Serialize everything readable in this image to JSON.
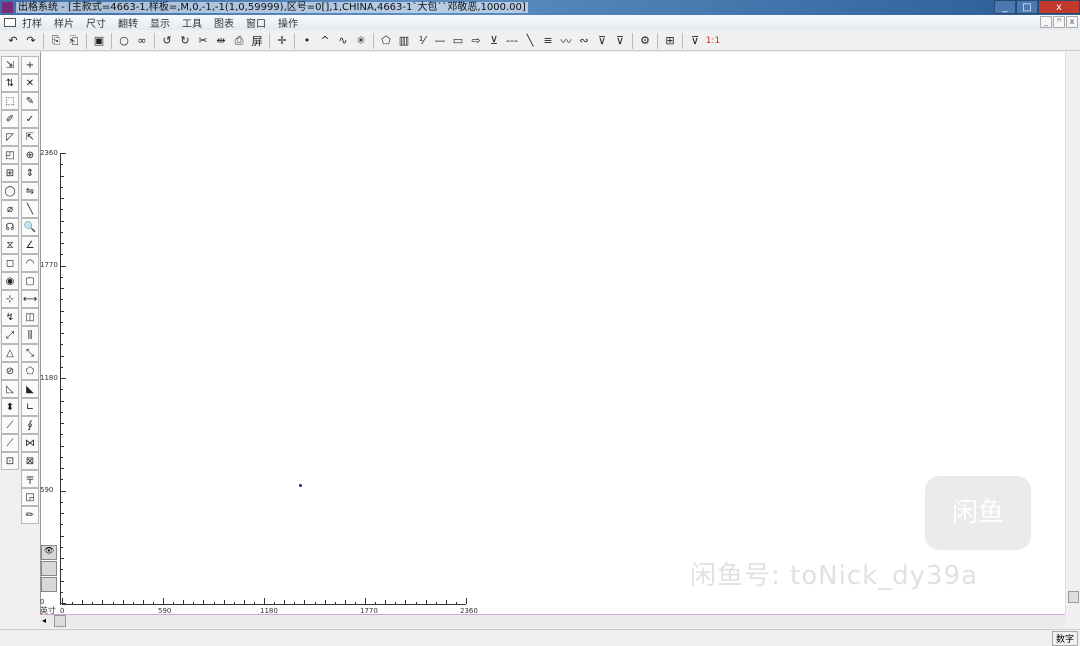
{
  "window": {
    "title": "出格系统 - [主款式=4663-1,样板=,M,0,-1,-1(1,0,59999),区号=0[],1,CHINA,4663-1`大包``邓敬恶,1000.00]",
    "minimize": "_",
    "maximize": "□",
    "close": "x"
  },
  "menu": [
    "打样",
    "样片",
    "尺寸",
    "翻转",
    "显示",
    "工具",
    "图表",
    "窗口",
    "操作"
  ],
  "mdi": [
    "_",
    "ꟸ",
    "x"
  ],
  "toolbar": [
    [
      "↶",
      "open-icon"
    ],
    [
      "↷",
      "save-icon"
    ],
    "|",
    [
      "⎘",
      "copy-piece-icon"
    ],
    [
      "⎗",
      "paste-piece-icon"
    ],
    "|",
    [
      "▣",
      "print-icon"
    ],
    "|",
    [
      "○",
      "circle-icon"
    ],
    [
      "∞",
      "group-icon"
    ],
    "|",
    [
      "↺",
      "undo-icon"
    ],
    [
      "↻",
      "redo-icon"
    ],
    [
      "✂",
      "cut-icon"
    ],
    [
      "⇹",
      "mirror-icon"
    ],
    [
      "⎙",
      "clipboard-icon"
    ],
    [
      "屏",
      "screen-icon"
    ],
    "|",
    [
      "✛",
      "crosshair-icon"
    ],
    "|",
    [
      "•",
      "point-icon"
    ],
    [
      "^",
      "peak-icon"
    ],
    [
      "∿",
      "curve-icon"
    ],
    [
      "✳",
      "star-icon"
    ],
    "|",
    [
      "⬠",
      "notch-icon"
    ],
    [
      "▥",
      "grid-icon"
    ],
    [
      "⅟",
      "ruler-icon"
    ],
    [
      "—",
      "line-icon"
    ],
    [
      "▭",
      "rect-icon"
    ],
    [
      "⇨",
      "arrow-icon"
    ],
    [
      "⊻",
      "dart-icon"
    ],
    [
      "---",
      "dash-icon"
    ],
    [
      "╲",
      "diagonal-icon"
    ],
    [
      "≡",
      "triple-line-icon"
    ],
    [
      "〰",
      "zigzag-icon"
    ],
    [
      "∾",
      "wave-icon"
    ],
    [
      "⊽",
      "dart2-icon"
    ],
    [
      "⊽",
      "dart3-icon"
    ],
    "|",
    [
      "⚙",
      "layout-icon"
    ],
    "|",
    [
      "⊞",
      "mark-icon"
    ],
    "|",
    [
      "⊽",
      "disabled-icon"
    ],
    [
      "1:1",
      "scale-icon"
    ]
  ],
  "left_tools": [
    "⇲",
    "+",
    "⇅",
    "✕",
    "⬚",
    "✎",
    "✐",
    "✓",
    "◸",
    "⇱",
    "◰",
    "⊕",
    "⊞",
    "⇕",
    "◯",
    "⇋",
    "⌀",
    "╲",
    "☊",
    "🔍",
    "⧖",
    "∠",
    "◻",
    "◠",
    "◉",
    "▢",
    "⊹",
    "⟷",
    "↯",
    "◫",
    "⤢",
    "⫼",
    "△",
    "⤡",
    "⊘",
    "⬠",
    "◺",
    "◣",
    "⬍",
    "∟",
    "⟋",
    "∮",
    "⟋",
    "⋈",
    "⊡",
    "⊠"
  ],
  "left_tools_extra": [
    "〒",
    "◲",
    "✏"
  ],
  "panel": [
    "👁",
    "",
    ""
  ],
  "ruler": {
    "unit": "英寸",
    "y_labels": [
      "2360",
      "1770",
      "1180",
      "590",
      "0"
    ],
    "x_labels": [
      "0",
      "590",
      "1180",
      "1770",
      "2360"
    ]
  },
  "status": {
    "mode": "数字"
  },
  "watermark": {
    "text": "闲鱼号: toNick_dy39a",
    "logo": "闲鱼"
  }
}
